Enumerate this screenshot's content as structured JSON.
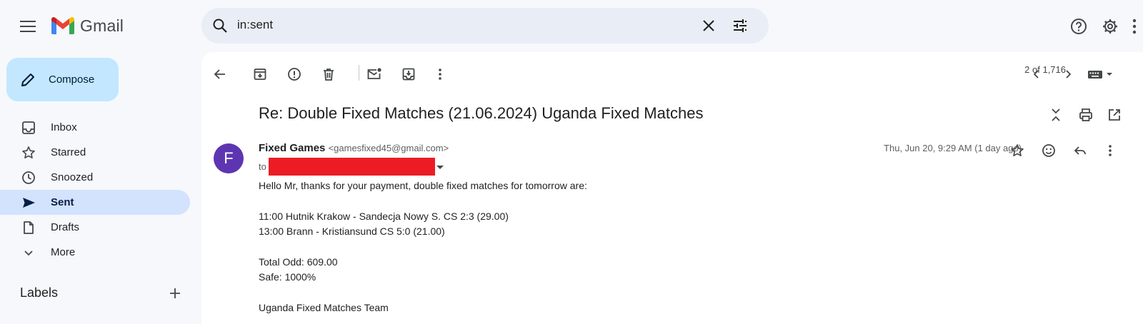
{
  "app": {
    "name": "Gmail"
  },
  "search": {
    "value": "in:sent"
  },
  "sidebar": {
    "compose_label": "Compose",
    "items": [
      {
        "label": "Inbox",
        "icon": "inbox-icon"
      },
      {
        "label": "Starred",
        "icon": "star-icon"
      },
      {
        "label": "Snoozed",
        "icon": "clock-icon"
      },
      {
        "label": "Sent",
        "icon": "send-icon",
        "active": true
      },
      {
        "label": "Drafts",
        "icon": "draft-icon"
      },
      {
        "label": "More",
        "icon": "chevron-down-icon"
      }
    ],
    "labels_title": "Labels"
  },
  "toolbar": {
    "pager": "2 of 1,716"
  },
  "message": {
    "subject": "Re: Double Fixed Matches (21.06.2024) Uganda Fixed Matches",
    "avatar_letter": "F",
    "avatar_color": "#5e35b1",
    "sender_name": "Fixed Games",
    "sender_email": "<gamesfixed45@gmail.com>",
    "to_label": "to",
    "date": "Thu, Jun 20, 9:29 AM (1 day ago)",
    "body": [
      "Hello Mr, thanks for your payment, double fixed matches for tomorrow are:",
      "",
      "11:00 Hutnik Krakow - Sandecja Nowy S. CS 2:3 (29.00)",
      "13:00 Brann - Kristiansund CS 5:0 (21.00)",
      "",
      "Total Odd: 609.00",
      "Safe: 1000%",
      "",
      "Uganda Fixed Matches Team"
    ]
  },
  "colors": {
    "accent": "#d3e3fd",
    "compose_bg": "#c2e7ff",
    "redaction": "#ed1c24"
  }
}
